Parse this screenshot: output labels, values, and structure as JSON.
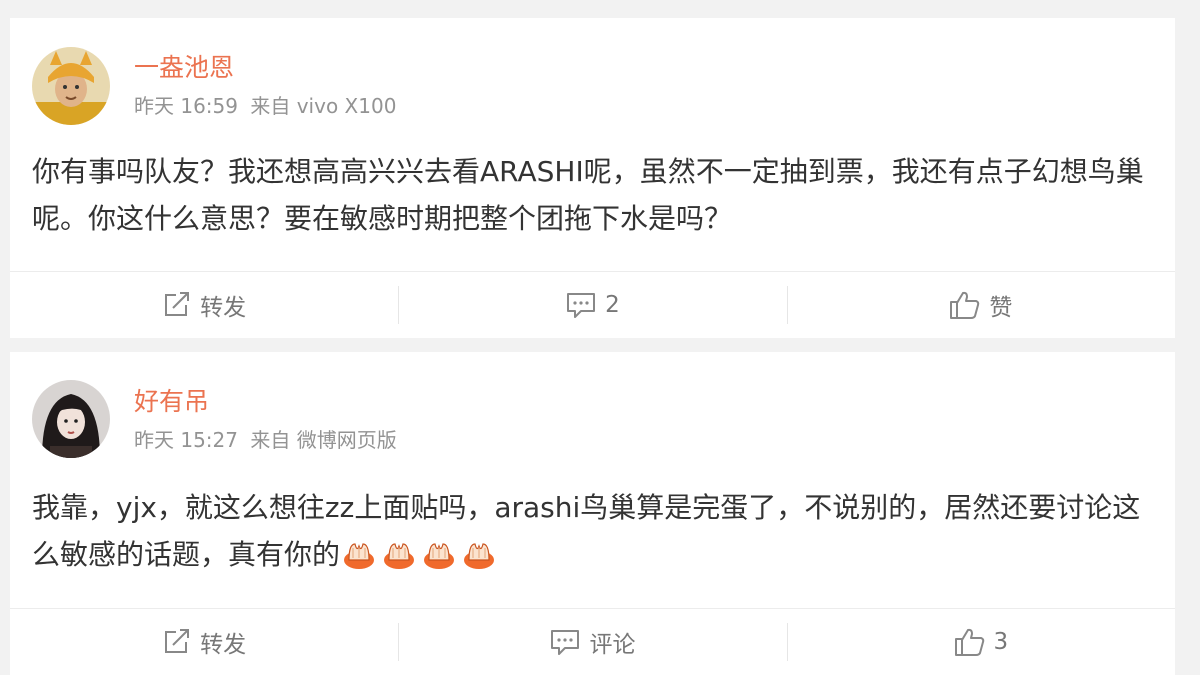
{
  "posts": [
    {
      "username": "一盎池恩",
      "time": "昨天 16:59",
      "source": "来自 vivo X100",
      "text": "你有事吗队友？我还想高高兴兴去看ARASHI呢，虽然不一定抽到票，我还有点子幻想鸟巢呢。你这什么意思？要在敏感时期把整个团拖下水是吗？",
      "actions": {
        "repost_label": "转发",
        "comment_label": "2",
        "like_label": "赞"
      }
    },
    {
      "username": "好有吊",
      "time": "昨天 15:27",
      "source": "来自 微博网页版",
      "text": "我靠，yjx，就这么想往zz上面贴吗，arashi鸟巢算是完蛋了，不说别的，居然还要讨论这么敏感的话题，真有你的",
      "emoji_count": 4,
      "actions": {
        "repost_label": "转发",
        "comment_label": "评论",
        "like_label": "3"
      }
    }
  ],
  "colors": {
    "username": "#eb7350",
    "meta": "#939393",
    "text": "#333333",
    "action": "#777777"
  },
  "icons": [
    "repost-icon",
    "comment-icon",
    "like-icon",
    "clap-emoji"
  ]
}
